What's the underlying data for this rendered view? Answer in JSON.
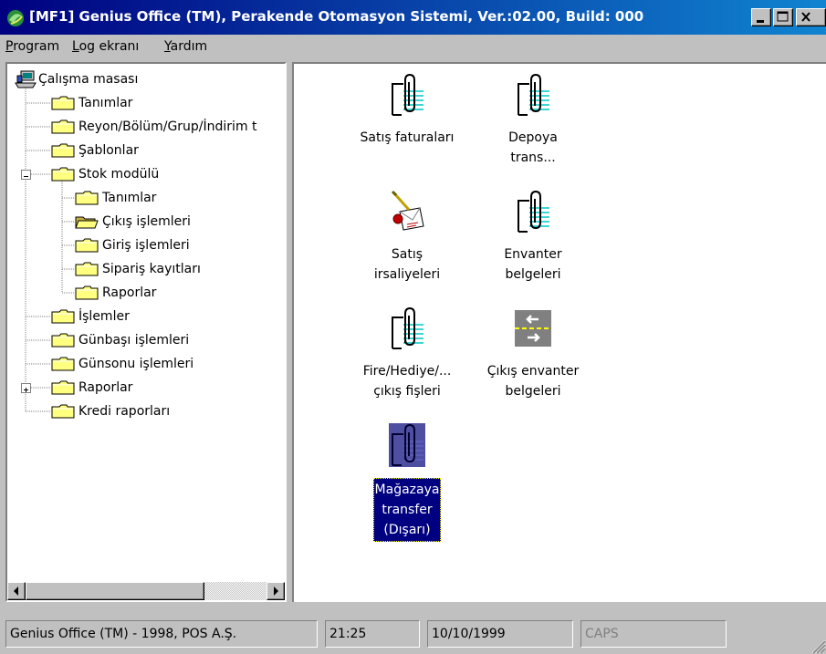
{
  "window": {
    "title": "[MF1] Genius Office (TM), Perakende Otomasyon Sistemi, Ver.:02.00, Build: 000",
    "title_bar_color": "#000080"
  },
  "menu": {
    "items": [
      {
        "label": "Program",
        "access_key": "P"
      },
      {
        "label": "Log ekranı",
        "access_key": "L"
      },
      {
        "label": "Yardım",
        "access_key": "Y"
      }
    ]
  },
  "tree": {
    "root": "Çalışma masası",
    "items": [
      {
        "label": "Tanımlar",
        "level": 1
      },
      {
        "label": "Reyon/Bölüm/Grup/İndirim t",
        "level": 1
      },
      {
        "label": "Şablonlar",
        "level": 1
      },
      {
        "label": "Stok modülü",
        "level": 1,
        "expander": "-"
      },
      {
        "label": "Tanımlar",
        "level": 2
      },
      {
        "label": "Çıkış işlemleri",
        "level": 2,
        "open": true
      },
      {
        "label": "Giriş işlemleri",
        "level": 2
      },
      {
        "label": "Sipariş kayıtları",
        "level": 2
      },
      {
        "label": "Raporlar",
        "level": 2
      },
      {
        "label": "İşlemler",
        "level": 1
      },
      {
        "label": "Günbaşı işlemleri",
        "level": 1
      },
      {
        "label": "Günsonu işlemleri",
        "level": 1
      },
      {
        "label": "Raporlar",
        "level": 1,
        "expander": "+"
      },
      {
        "label": "Kredi raporları",
        "level": 1
      }
    ]
  },
  "icons": [
    {
      "caption": "Satış faturaları",
      "icon": "paperclip-document-icon"
    },
    {
      "caption": "Depoya\ntrans...",
      "icon": "paperclip-document-icon"
    },
    {
      "caption": "Satış\nirsaliyeleri",
      "icon": "signed-letter-icon"
    },
    {
      "caption": "Envanter\nbelgeleri",
      "icon": "paperclip-document-icon"
    },
    {
      "caption": "Fire/Hediye/...\nçıkış fişleri",
      "icon": "paperclip-document-icon"
    },
    {
      "caption": "Çıkış envanter\nbelgeleri",
      "icon": "road-transfer-arrows-icon"
    },
    {
      "caption": "Mağazaya\ntransfer\n(Dışarı)",
      "icon": "paperclip-document-icon",
      "selected": true
    }
  ],
  "status": {
    "company": "Genius Office (TM) - 1998, POS A.Ş.",
    "time": "21:25",
    "date": "10/10/1999",
    "caps": "CAPS"
  }
}
